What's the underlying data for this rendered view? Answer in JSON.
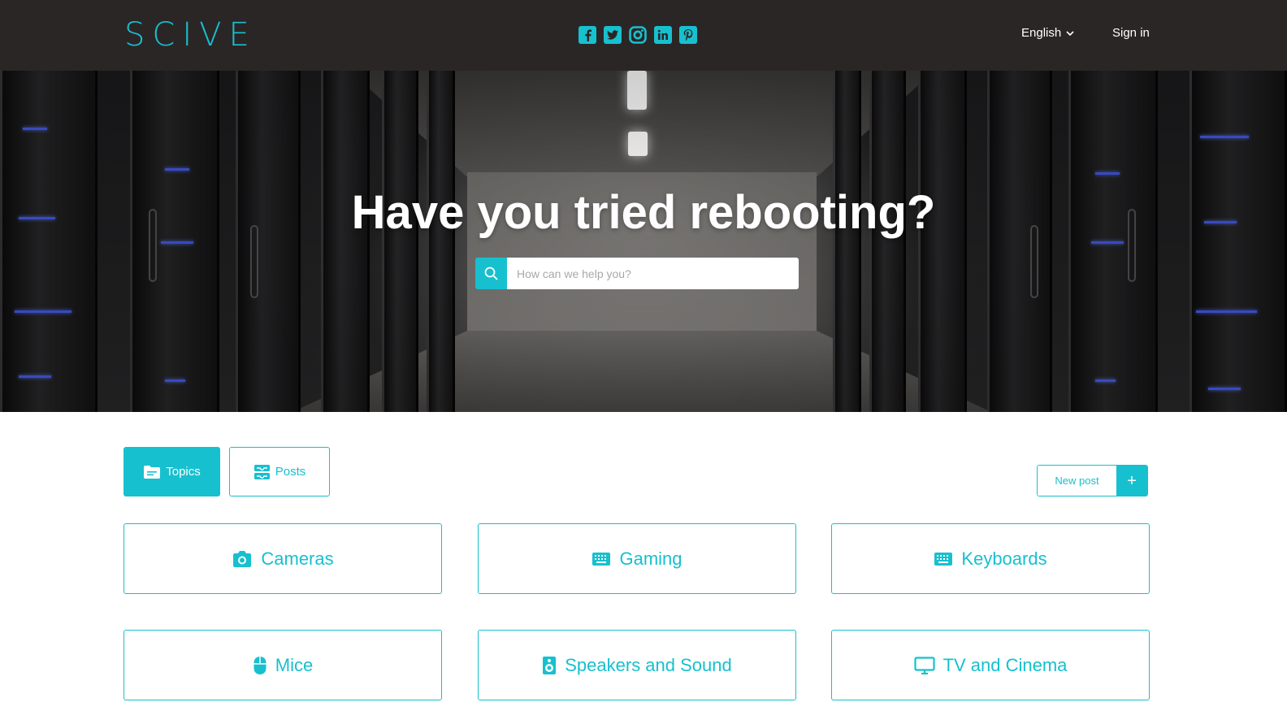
{
  "header": {
    "logo": "SCIVE",
    "social_icons": [
      "facebook-icon",
      "twitter-icon",
      "instagram-icon",
      "linkedin-icon",
      "pinterest-icon"
    ],
    "language": "English",
    "sign_in": "Sign in"
  },
  "hero": {
    "title": "Have you tried rebooting?",
    "search_placeholder": "How can we help you?",
    "search_value": ""
  },
  "tabs": {
    "topics": "Topics",
    "posts": "Posts",
    "active": "Topics"
  },
  "new_post": {
    "label": "New post",
    "plus": "+"
  },
  "topics": [
    {
      "label": "Cameras",
      "icon": "camera-icon"
    },
    {
      "label": "Gaming",
      "icon": "keyboard-icon"
    },
    {
      "label": "Keyboards",
      "icon": "keyboard-icon"
    },
    {
      "label": "Mice",
      "icon": "mouse-icon"
    },
    {
      "label": "Speakers and Sound",
      "icon": "speaker-icon"
    },
    {
      "label": "TV and Cinema",
      "icon": "monitor-icon"
    }
  ],
  "colors": {
    "accent": "#17c0cf",
    "header_bg": "#2b2626",
    "text_on_dark": "#ffffff"
  }
}
